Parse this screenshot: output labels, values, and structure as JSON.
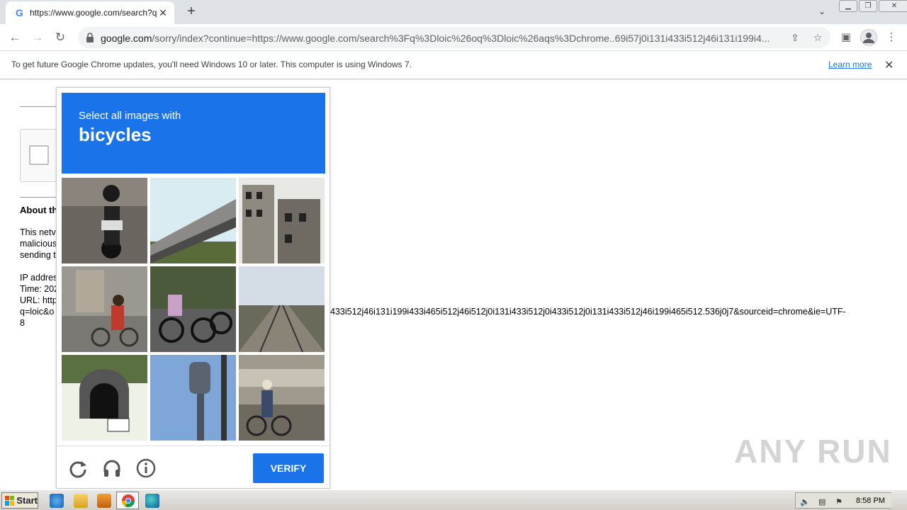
{
  "browser": {
    "tab_title": "https://www.google.com/search?q=",
    "tab_favicon": "G",
    "url_domain": "google.com",
    "url_path": "/sorry/index?continue=https://www.google.com/search%3Fq%3Dloic%26oq%3Dloic%26aqs%3Dchrome..69i57j0i131i433i512j46i131i199i4..."
  },
  "infobar": {
    "message": "To get future Google Chrome updates, you'll need Windows 10 or later. This computer is using Windows 7.",
    "learn_more": "Learn more"
  },
  "page": {
    "about_heading": "About th",
    "para1": [
      "This netv",
      "malicious",
      "sending t"
    ],
    "para2": [
      "IP addres",
      "Time: 202",
      "URL: http",
      "q=loic&o",
      "8"
    ],
    "url_tail": "433i512j46i131i199i433i465i512j46i512j0i131i433i512j0i433i512j0i131i433i512j46i199i465i512.536j0j7&sourceid=chrome&ie=UTF-"
  },
  "captcha": {
    "prompt_line1": "Select all images with",
    "prompt_line2": "bicycles",
    "verify_label": "VERIFY",
    "accent": "#1a73e8"
  },
  "watermark": "ANY RUN",
  "taskbar": {
    "start_label": "Start",
    "clock": "8:58 PM"
  }
}
